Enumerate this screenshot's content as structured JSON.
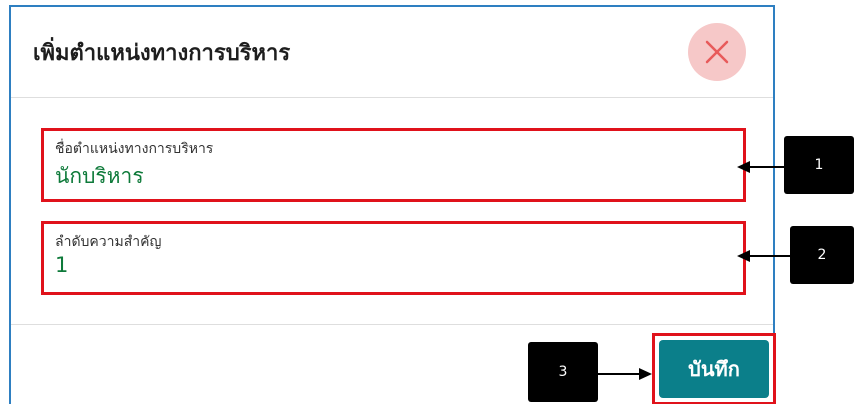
{
  "dialog": {
    "title": "เพิ่มตำแหน่งทางการบริหาร",
    "close_icon": "close-icon",
    "fields": [
      {
        "label": "ชื่อตำแหน่งทางการบริหาร",
        "value": "นักบริหาร"
      },
      {
        "label": "ลำดับความสำคัญ",
        "value": "1"
      }
    ],
    "save_label": "บันทึก"
  },
  "annotations": {
    "callout_1": "1",
    "callout_2": "2",
    "callout_3": "3"
  },
  "colors": {
    "highlight": "#e0121b",
    "value_text": "#0e7a3a",
    "save_button": "#0b7f8a",
    "close_circle": "#f6c8c8",
    "close_x": "#e85a5a",
    "dialog_border": "#2e7fc1"
  }
}
